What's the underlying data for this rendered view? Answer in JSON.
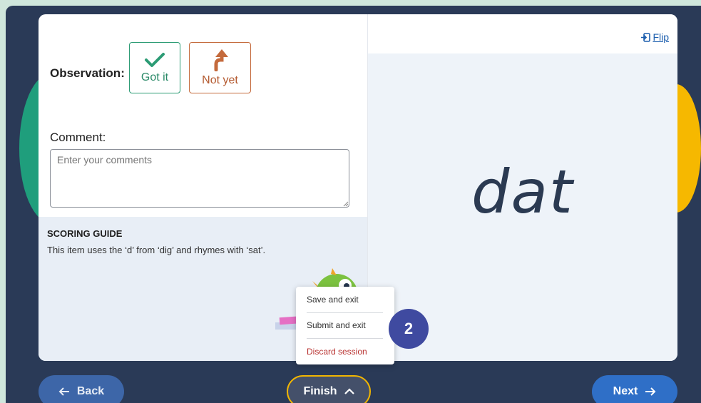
{
  "observation": {
    "label": "Observation:",
    "got_it": "Got it",
    "not_yet": "Not yet"
  },
  "comment": {
    "label": "Comment:",
    "placeholder": "Enter your comments",
    "value": ""
  },
  "scoring_guide": {
    "title": "SCORING GUIDE",
    "text": "This item uses the ‘d’ from ‘dig’ and rhymes with ‘sat’."
  },
  "card": {
    "flip_label": "Flip",
    "word": "dat"
  },
  "finish_menu": {
    "items": [
      "Save and exit",
      "Submit and exit",
      "Discard session"
    ]
  },
  "step_badge": "2",
  "nav": {
    "back": "Back",
    "finish": "Finish",
    "next": "Next"
  },
  "colors": {
    "frame": "#2a3a57",
    "accent_green": "#2b9b74",
    "accent_orange": "#c46a3c",
    "primary_blue": "#2f6fc7",
    "finish_outline": "#f2b600",
    "badge": "#3f4aa0",
    "danger": "#b8312f"
  }
}
